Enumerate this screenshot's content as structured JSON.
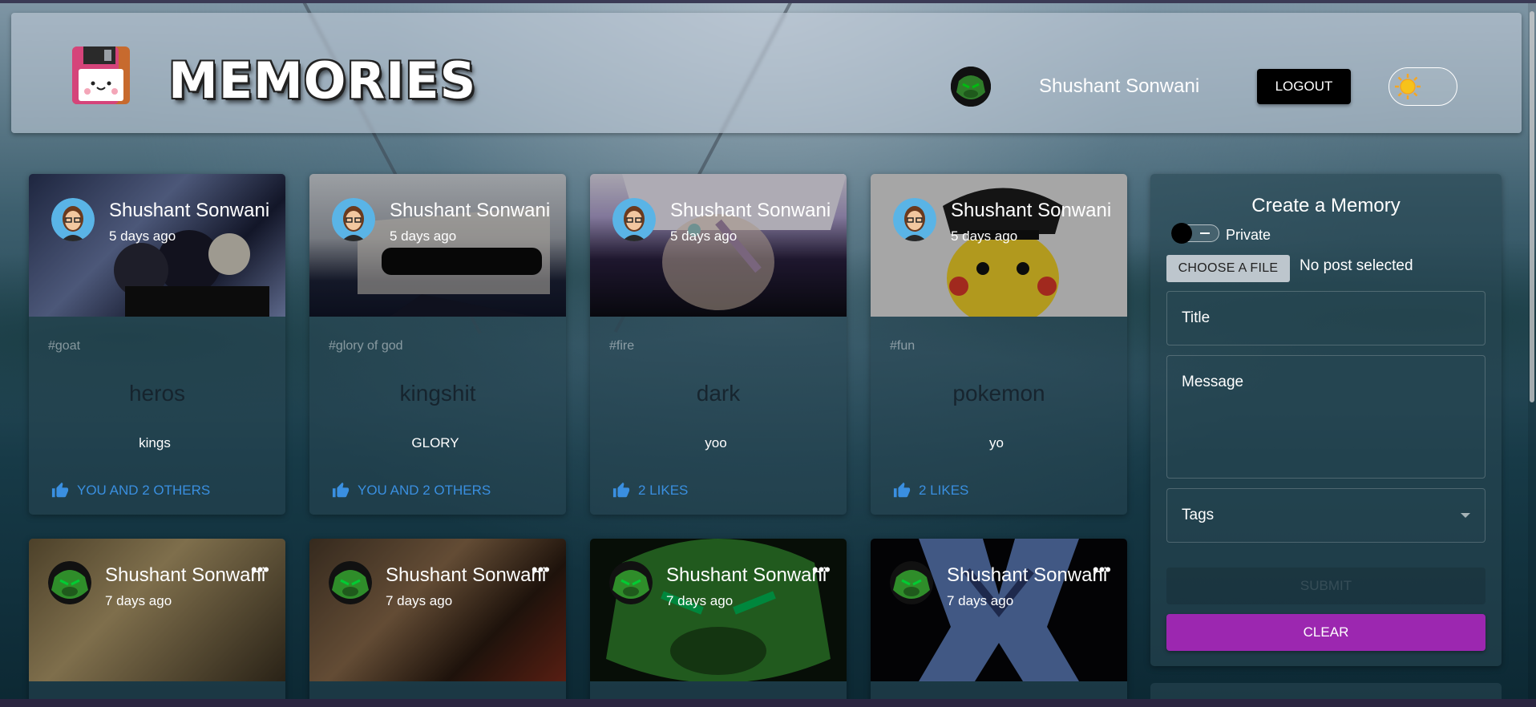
{
  "app": {
    "logo_text": "MEMORIES",
    "user_name": "Shushant Sonwani",
    "logout_label": "LOGOUT",
    "theme_icon": "sun-icon"
  },
  "posts_row1": [
    {
      "author": "Shushant Sonwani",
      "time": "5 days ago",
      "tags": "#goat",
      "title": "heros",
      "message": "kings",
      "likes": "YOU AND 2 OTHERS"
    },
    {
      "author": "Shushant Sonwani",
      "time": "5 days ago",
      "tags": "#glory of god",
      "title": "kingshit",
      "message": "GLORY",
      "likes": "YOU AND 2 OTHERS"
    },
    {
      "author": "Shushant Sonwani",
      "time": "5 days ago",
      "tags": "#fire",
      "title": "dark",
      "message": "yoo",
      "likes": "2 LIKES"
    },
    {
      "author": "Shushant Sonwani",
      "time": "5 days ago",
      "tags": "#fun",
      "title": "pokemon",
      "message": "yo",
      "likes": "2 LIKES"
    }
  ],
  "posts_row2": [
    {
      "author": "Shushant Sonwani",
      "time": "7 days ago"
    },
    {
      "author": "Shushant Sonwani",
      "time": "7 days ago"
    },
    {
      "author": "Shushant Sonwani",
      "time": "7 days ago"
    },
    {
      "author": "Shushant Sonwani",
      "time": "7 days ago"
    }
  ],
  "form": {
    "title": "Create a Memory",
    "private_label": "Private",
    "choose_file_label": "CHOOSE A FILE",
    "file_status": "No post selected",
    "title_placeholder": "Title",
    "message_placeholder": "Message",
    "tags_placeholder": "Tags",
    "submit_label": "SUBMIT",
    "clear_label": "CLEAR"
  },
  "colors": {
    "like_blue": "#3a8fe0",
    "clear_purple": "#9c27b0",
    "logout_black": "#000000"
  }
}
